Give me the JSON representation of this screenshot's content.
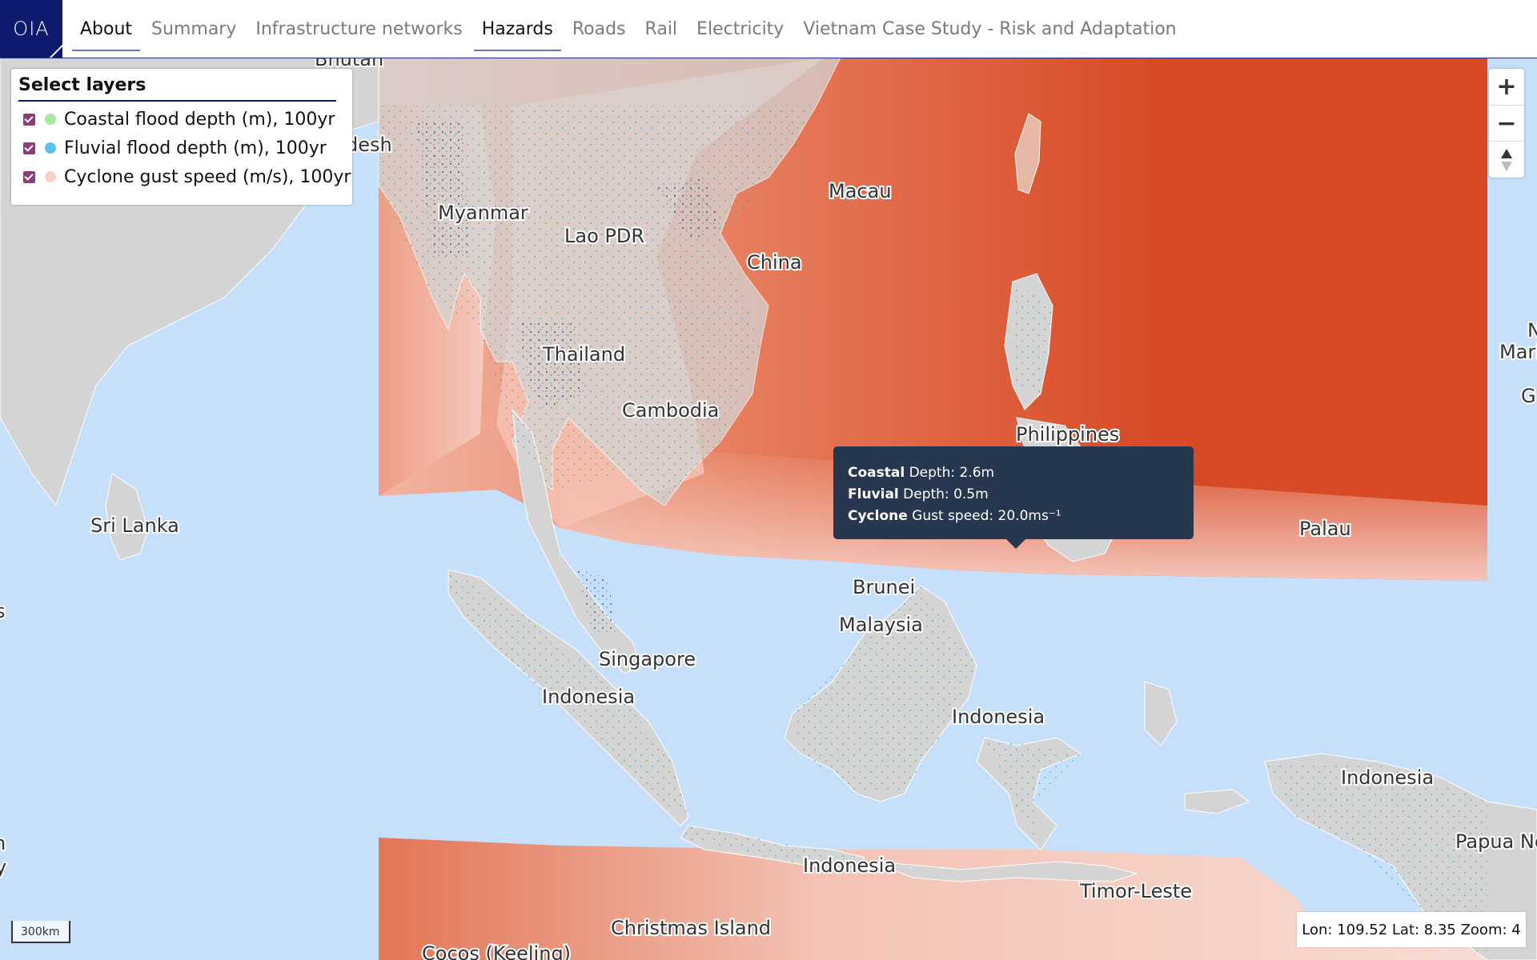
{
  "logo": "OIA",
  "nav": {
    "items": [
      {
        "label": "About",
        "state": "active"
      },
      {
        "label": "Summary",
        "state": ""
      },
      {
        "label": "Infrastructure networks",
        "state": ""
      },
      {
        "label": "Hazards",
        "state": "current"
      },
      {
        "label": "Roads",
        "state": ""
      },
      {
        "label": "Rail",
        "state": ""
      },
      {
        "label": "Electricity",
        "state": ""
      },
      {
        "label": "Vietnam Case Study - Risk and Adaptation",
        "state": ""
      }
    ]
  },
  "layers_panel": {
    "title": "Select layers",
    "layers": [
      {
        "label": "Coastal flood depth (m), 100yr",
        "checked": true,
        "color": "#a8e6a2"
      },
      {
        "label": "Fluvial flood depth (m), 100yr",
        "checked": true,
        "color": "#5bc0eb"
      },
      {
        "label": "Cyclone gust speed (m/s), 100yr",
        "checked": true,
        "color": "#f8d0c6"
      }
    ]
  },
  "zoom": {
    "in_icon": "plus-icon",
    "out_icon": "minus-icon",
    "compass_icon": "compass-icon"
  },
  "map_labels": [
    "Bhutan",
    "desh",
    "Myanmar",
    "Lao PDR",
    "Macau",
    "China",
    "Thailand",
    "Cambodia",
    "Philippines",
    "Palau",
    "Sri Lanka",
    "Brunei",
    "Malaysia",
    "Singapore",
    "Indonesia",
    "Indonesia",
    "Indonesia",
    "Indonesia",
    "Papua Ne",
    "Timor-Leste",
    "Christmas Island",
    "Cocos (Keeling)",
    "N",
    "Mari",
    "G",
    "s",
    "n",
    "y"
  ],
  "tooltip": {
    "line1_bold": "Coastal",
    "line1": " Depth: 2.6m",
    "line2_bold": "Fluvial",
    "line2": " Depth: 0.5m",
    "line3_bold": "Cyclone",
    "line3": " Gust speed: 20.0ms⁻¹"
  },
  "scale": "300km",
  "coords": "Lon: 109.52 Lat: 8.35 Zoom: 4",
  "colors": {
    "ocean": "#c6e0fb",
    "land": "#d4d4d4",
    "hazard_high": "#d84a26",
    "hazard_low": "#f7d3ca",
    "nav_dark": "#0d1a6e"
  }
}
